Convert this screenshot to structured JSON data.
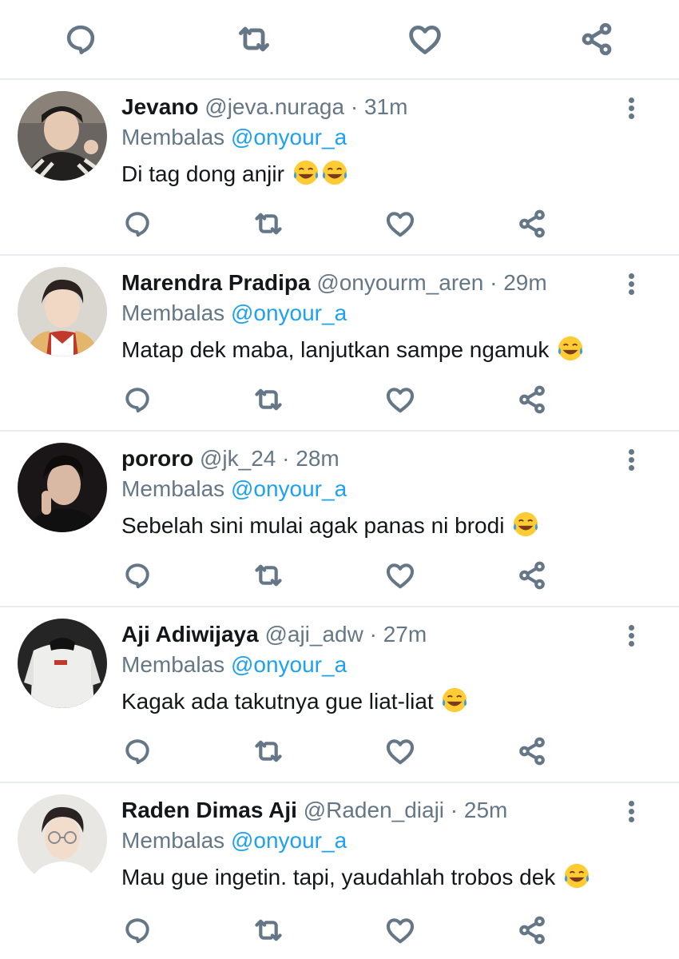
{
  "icons": {
    "reply": "reply-icon",
    "retweet": "retweet-icon",
    "like": "like-icon",
    "share": "share-icon",
    "more": "more-vertical-icon",
    "emoji": "tears-of-joy-emoji"
  },
  "colors": {
    "text": "#14171a",
    "muted": "#657786",
    "mention": "#1da1f2",
    "divider": "#e6ecf0"
  },
  "tweets": [
    {
      "name": "Jevano",
      "handle": "@jeva.nuraga",
      "time": "31m",
      "reply_prefix": "Membalas",
      "reply_to": "@onyour_a",
      "text": "Di tag dong anjir",
      "emoji_count": 2
    },
    {
      "name": "Marendra Pradipa",
      "handle": "@onyourm_aren",
      "time": "29m",
      "reply_prefix": "Membalas",
      "reply_to": "@onyour_a",
      "text": "Matap dek maba, lanjutkan sampe ngamuk",
      "emoji_count": 1
    },
    {
      "name": "pororo",
      "handle": "@jk_24",
      "time": "28m",
      "reply_prefix": "Membalas",
      "reply_to": "@onyour_a",
      "text": "Sebelah sini mulai agak panas ni brodi",
      "emoji_count": 1
    },
    {
      "name": "Aji Adiwijaya",
      "handle": "@aji_adw",
      "time": "27m",
      "reply_prefix": "Membalas",
      "reply_to": "@onyour_a",
      "text": "Kagak ada takutnya gue liat-liat",
      "emoji_count": 1
    },
    {
      "name": "Raden Dimas Aji",
      "handle": "@Raden_diaji",
      "time": "25m",
      "reply_prefix": "Membalas",
      "reply_to": "@onyour_a",
      "text": "Mau gue ingetin. tapi, yaudahlah trobos dek",
      "emoji_count": 1
    }
  ]
}
